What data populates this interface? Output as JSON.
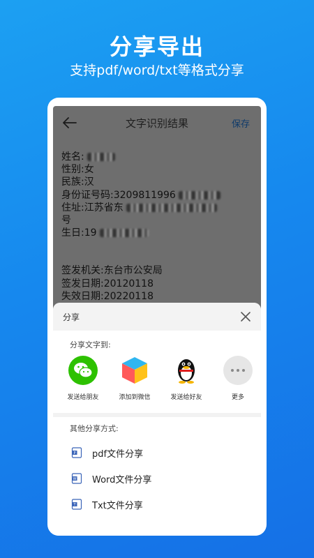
{
  "promo": {
    "title": "分享导出",
    "subtitle": "支持pdf/word/txt等格式分享"
  },
  "screen": {
    "title": "文字识别结果",
    "save_label": "保存",
    "back_icon": "arrow-left-icon"
  },
  "ocr": {
    "lines": [
      {
        "label": "姓名:",
        "value": ""
      },
      {
        "label": "性别:",
        "value": "女"
      },
      {
        "label": "民族:",
        "value": "汉"
      },
      {
        "label": "身份证号码:",
        "value": "3209811996"
      },
      {
        "label": "住址:",
        "value": "江苏省东"
      },
      {
        "label": "号",
        "value": ""
      },
      {
        "label": "生日:",
        "value": "19"
      }
    ],
    "issue_lines": [
      {
        "label": "签发机关:",
        "value": "东台市公安局"
      },
      {
        "label": "签发日期:",
        "value": "20120118"
      },
      {
        "label": "失效日期:",
        "value": "20220118"
      }
    ]
  },
  "share_sheet": {
    "title": "分享",
    "share_text_to": "分享文字到:",
    "apps": [
      {
        "label": "发送给朋友",
        "icon": "wechat-icon",
        "color": "#2dc100"
      },
      {
        "label": "添加到微信",
        "icon": "cube-icon",
        "color": "#ffb300"
      },
      {
        "label": "发送给好友",
        "icon": "qq-penguin-icon",
        "color": "#111111"
      },
      {
        "label": "更多",
        "icon": "more-dots-icon",
        "color": "#e6e6e6"
      }
    ],
    "other_methods": "其他分享方式:",
    "file_options": [
      {
        "label": "pdf文件分享",
        "icon": "pdf-file-icon"
      },
      {
        "label": "Word文件分享",
        "icon": "word-file-icon"
      },
      {
        "label": "Txt文件分享",
        "icon": "txt-file-icon"
      }
    ]
  },
  "colors": {
    "background_start": "#1ca0f2",
    "background_end": "#1570e6",
    "file_icon_blue": "#3a64b8"
  }
}
